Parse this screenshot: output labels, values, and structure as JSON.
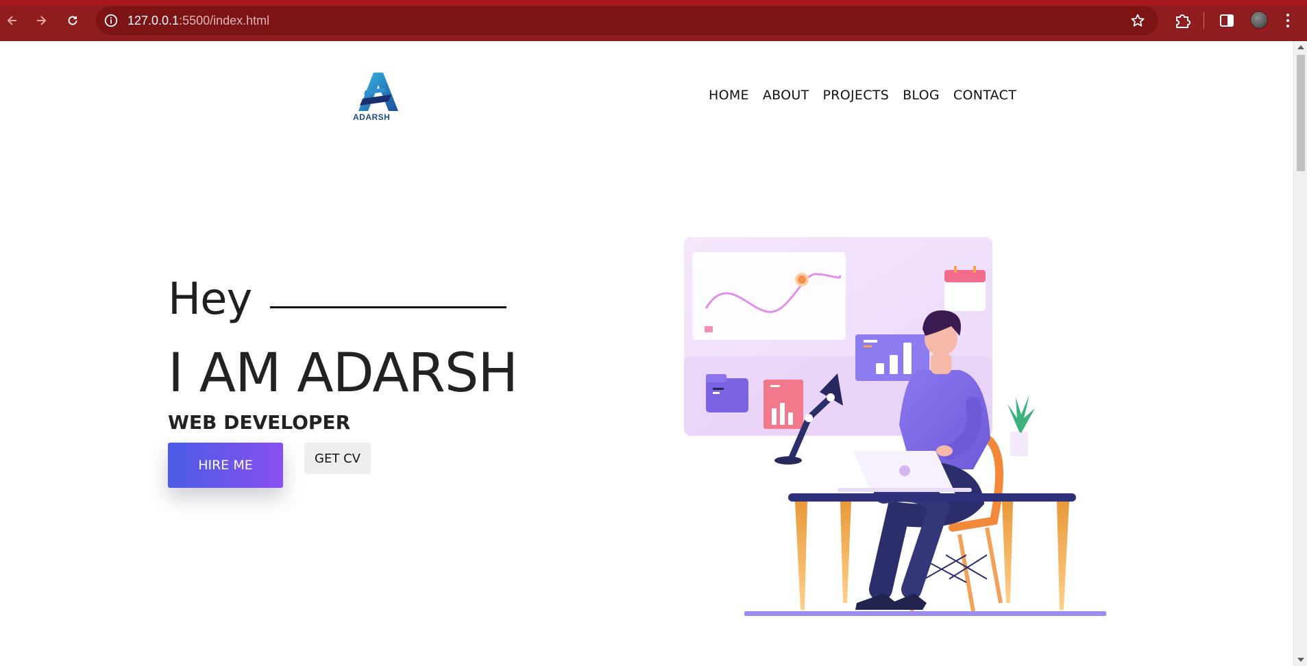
{
  "browser": {
    "url_host": "127.0.0.1",
    "url_rest": ":5500/index.html",
    "colors": {
      "frame": "#8f1d1f",
      "address_bar": "#7c1416"
    }
  },
  "site": {
    "logo_text": "ADARSH",
    "nav": [
      "HOME",
      "ABOUT",
      "PROJECTS",
      "BLOG",
      "CONTACT"
    ]
  },
  "hero": {
    "greeting": "Hey",
    "title": "I AM ADARSH",
    "subtitle": "WEB DEVELOPER",
    "primary_button": "HIRE ME",
    "secondary_button": "GET CV",
    "colors": {
      "button_gradient_start": "#4a5ce6",
      "button_gradient_end": "#8a4ff0"
    }
  }
}
